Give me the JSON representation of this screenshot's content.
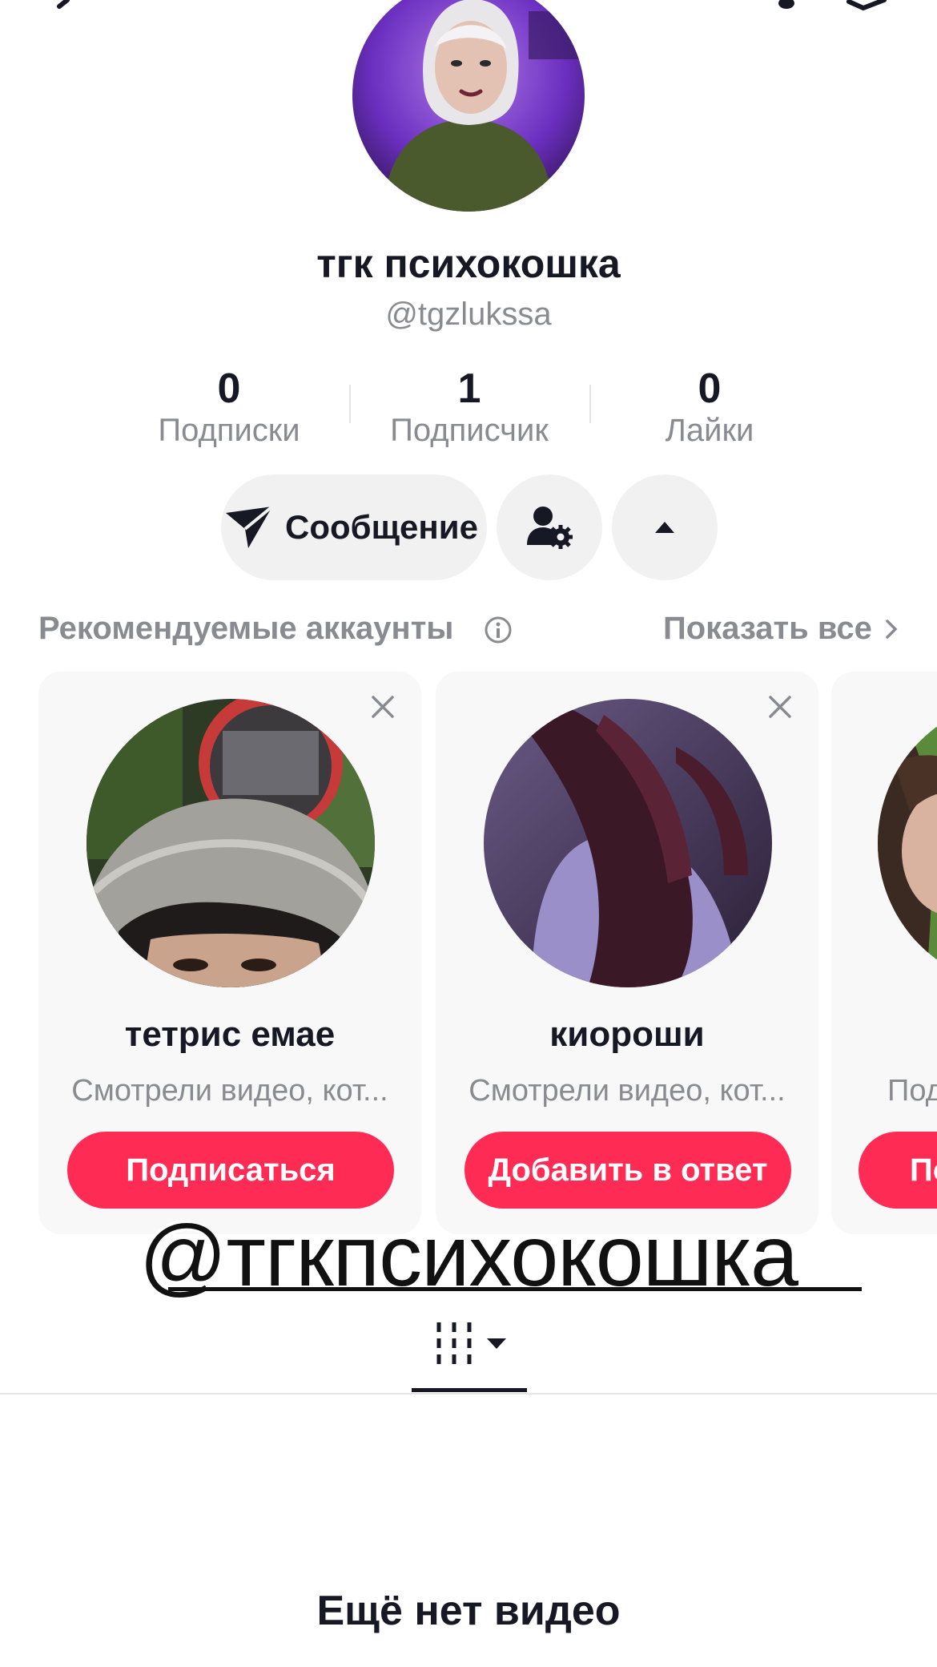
{
  "profile": {
    "display_name": "тгк психокошка",
    "username": "@tgzlukssa"
  },
  "stats": [
    {
      "value": "0",
      "label": "Подписки"
    },
    {
      "value": "1",
      "label": "Подписчик"
    },
    {
      "value": "0",
      "label": "Лайки"
    }
  ],
  "actions": {
    "message_label": "Сообщение"
  },
  "suggested": {
    "title": "Рекомендуемые аккаунты",
    "show_all": "Показать все",
    "cards": [
      {
        "name": "тетрис емае",
        "reason": "Смотрели видео, кот...",
        "button": "Подписаться"
      },
      {
        "name": "киороши",
        "reason": "Смотрели видео, кот...",
        "button": "Добавить в ответ"
      },
      {
        "name": "",
        "reason": "Под",
        "button": "По"
      }
    ]
  },
  "overlay_text": "@тгкпсихокошка",
  "empty_state": "Ещё нет видео",
  "colors": {
    "accent": "#fe2c55",
    "text_primary": "#161823",
    "text_secondary": "#8a8b91",
    "button_bg": "#f1f1f2",
    "card_bg": "#f8f8f8"
  },
  "icons": [
    "back-arrow-icon",
    "notification-bell-icon",
    "share-icon",
    "send-icon",
    "user-settings-icon",
    "caret-up-icon",
    "info-icon",
    "chevron-right-icon",
    "close-icon",
    "grid-icon",
    "caret-down-icon"
  ]
}
